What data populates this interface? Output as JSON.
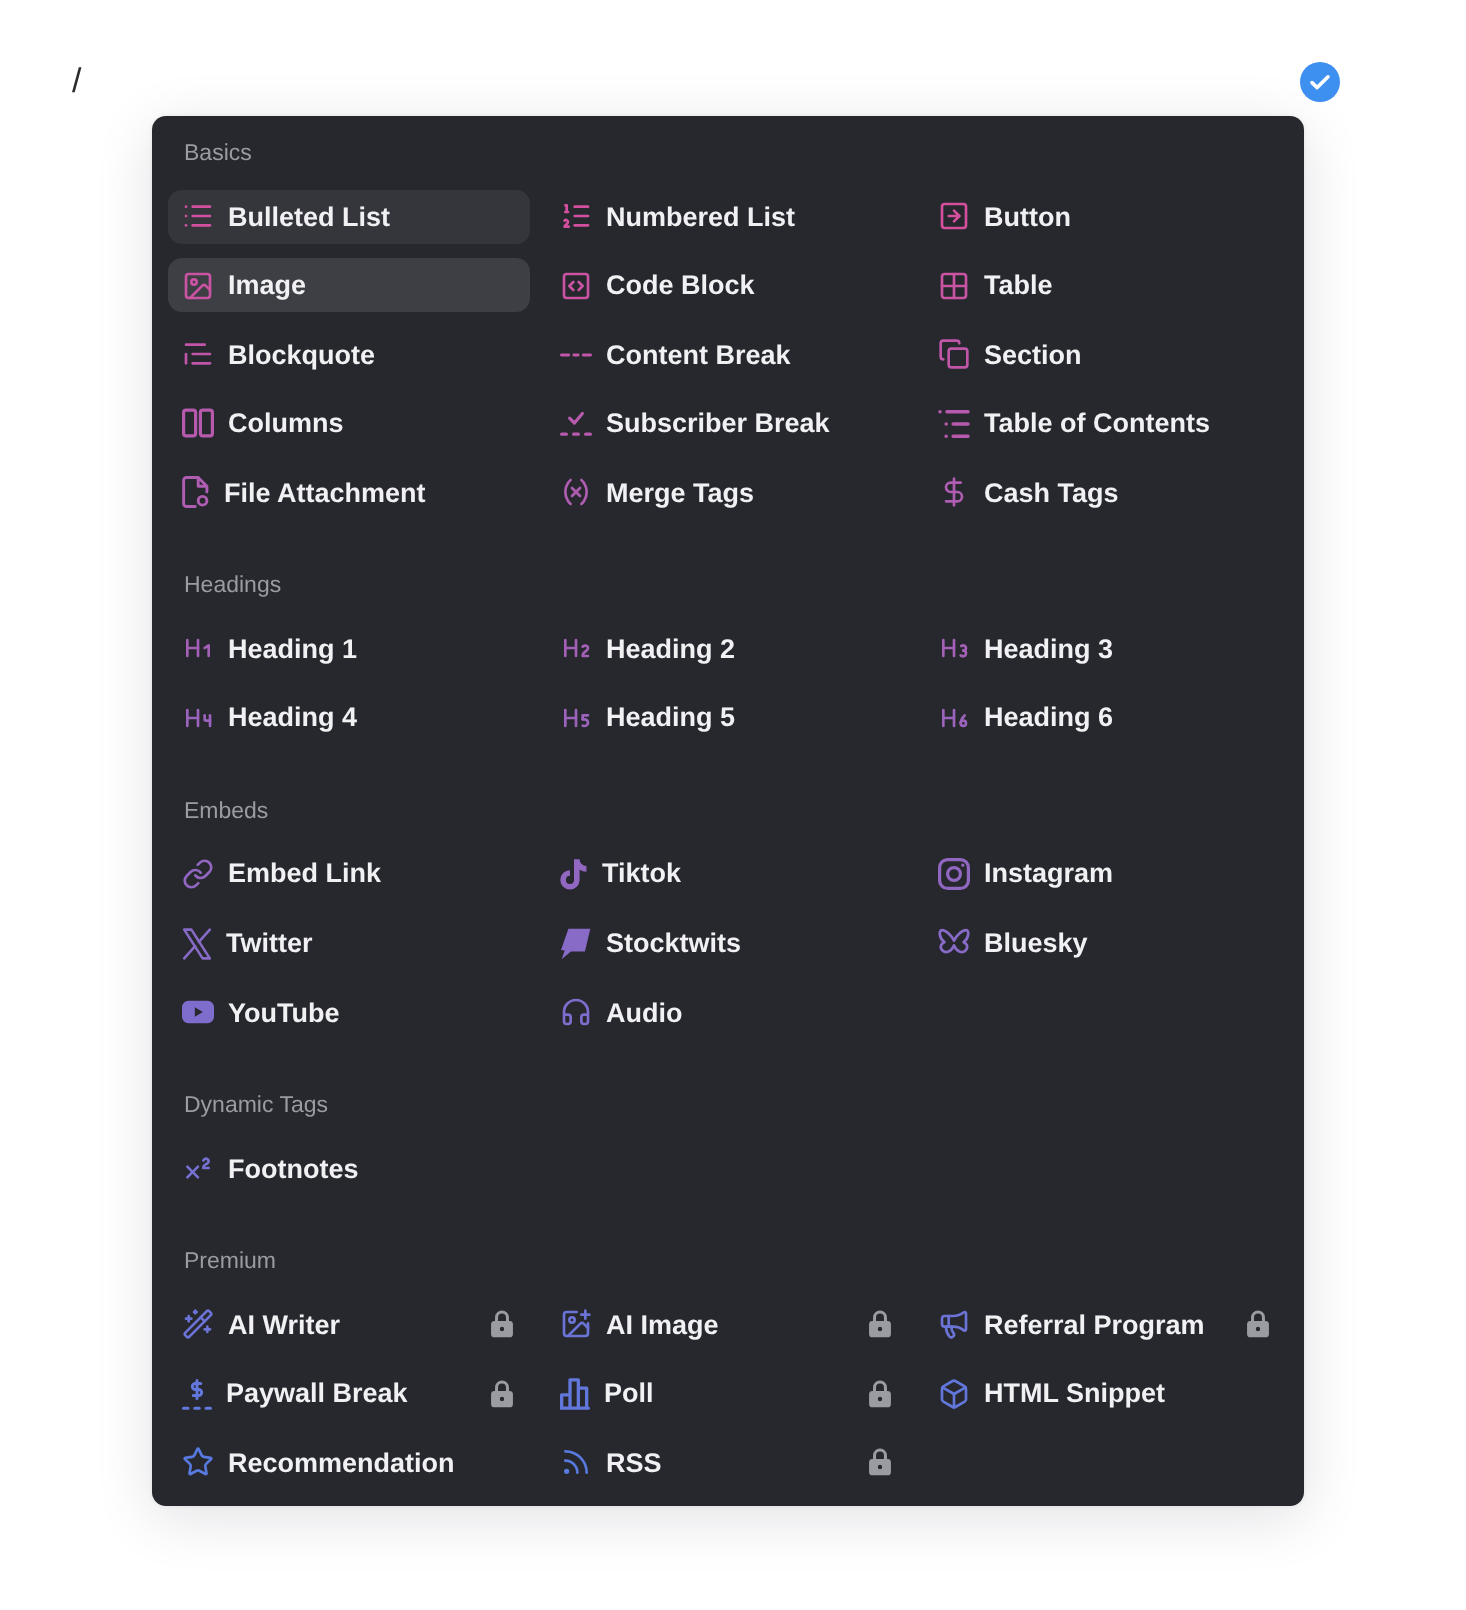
{
  "editor": {
    "text": "/"
  },
  "menu": {
    "sections": [
      {
        "title": "Basics",
        "items": [
          {
            "label": "Bulleted List",
            "selected": true,
            "hovered": false
          },
          {
            "label": "Numbered List",
            "selected": false,
            "hovered": false
          },
          {
            "label": "Button",
            "selected": false,
            "hovered": false
          },
          {
            "label": "Image",
            "selected": false,
            "hovered": true
          },
          {
            "label": "Code Block",
            "selected": false,
            "hovered": false
          },
          {
            "label": "Table",
            "selected": false,
            "hovered": false
          },
          {
            "label": "Blockquote",
            "selected": false,
            "hovered": false
          },
          {
            "label": "Content Break",
            "selected": false,
            "hovered": false
          },
          {
            "label": "Section",
            "selected": false,
            "hovered": false
          },
          {
            "label": "Columns",
            "selected": false,
            "hovered": false
          },
          {
            "label": "Subscriber Break",
            "selected": false,
            "hovered": false
          },
          {
            "label": "Table of Contents",
            "selected": false,
            "hovered": false
          },
          {
            "label": "File Attachment",
            "selected": false,
            "hovered": false
          },
          {
            "label": "Merge Tags",
            "selected": false,
            "hovered": false
          },
          {
            "label": "Cash Tags",
            "selected": false,
            "hovered": false
          }
        ]
      },
      {
        "title": "Headings",
        "items": [
          {
            "label": "Heading 1",
            "selected": false,
            "hovered": false
          },
          {
            "label": "Heading 2",
            "selected": false,
            "hovered": false
          },
          {
            "label": "Heading 3",
            "selected": false,
            "hovered": false
          },
          {
            "label": "Heading 4",
            "selected": false,
            "hovered": false
          },
          {
            "label": "Heading 5",
            "selected": false,
            "hovered": false
          },
          {
            "label": "Heading 6",
            "selected": false,
            "hovered": false
          }
        ]
      },
      {
        "title": "Embeds",
        "items": [
          {
            "label": "Embed Link",
            "selected": false,
            "hovered": false
          },
          {
            "label": "Tiktok",
            "selected": false,
            "hovered": false
          },
          {
            "label": "Instagram",
            "selected": false,
            "hovered": false
          },
          {
            "label": "Twitter",
            "selected": false,
            "hovered": false
          },
          {
            "label": "Stocktwits",
            "selected": false,
            "hovered": false
          },
          {
            "label": "Bluesky",
            "selected": false,
            "hovered": false
          },
          {
            "label": "YouTube",
            "selected": false,
            "hovered": false
          },
          {
            "label": "Audio",
            "selected": false,
            "hovered": false
          }
        ]
      },
      {
        "title": "Dynamic Tags",
        "items": [
          {
            "label": "Footnotes",
            "selected": false,
            "hovered": false
          }
        ]
      },
      {
        "title": "Premium",
        "items": [
          {
            "label": "AI Writer",
            "selected": false,
            "hovered": false,
            "locked": true
          },
          {
            "label": "AI Image",
            "selected": false,
            "hovered": false,
            "locked": true
          },
          {
            "label": "Referral Program",
            "selected": false,
            "hovered": false,
            "locked": true
          },
          {
            "label": "Paywall Break",
            "selected": false,
            "hovered": false,
            "locked": true
          },
          {
            "label": "Poll",
            "selected": false,
            "hovered": false,
            "locked": true
          },
          {
            "label": "HTML Snippet",
            "selected": false,
            "hovered": false,
            "locked": false
          },
          {
            "label": "Recommendation",
            "selected": false,
            "hovered": false,
            "locked": false
          },
          {
            "label": "RSS",
            "selected": false,
            "hovered": false,
            "locked": true
          }
        ]
      }
    ]
  }
}
